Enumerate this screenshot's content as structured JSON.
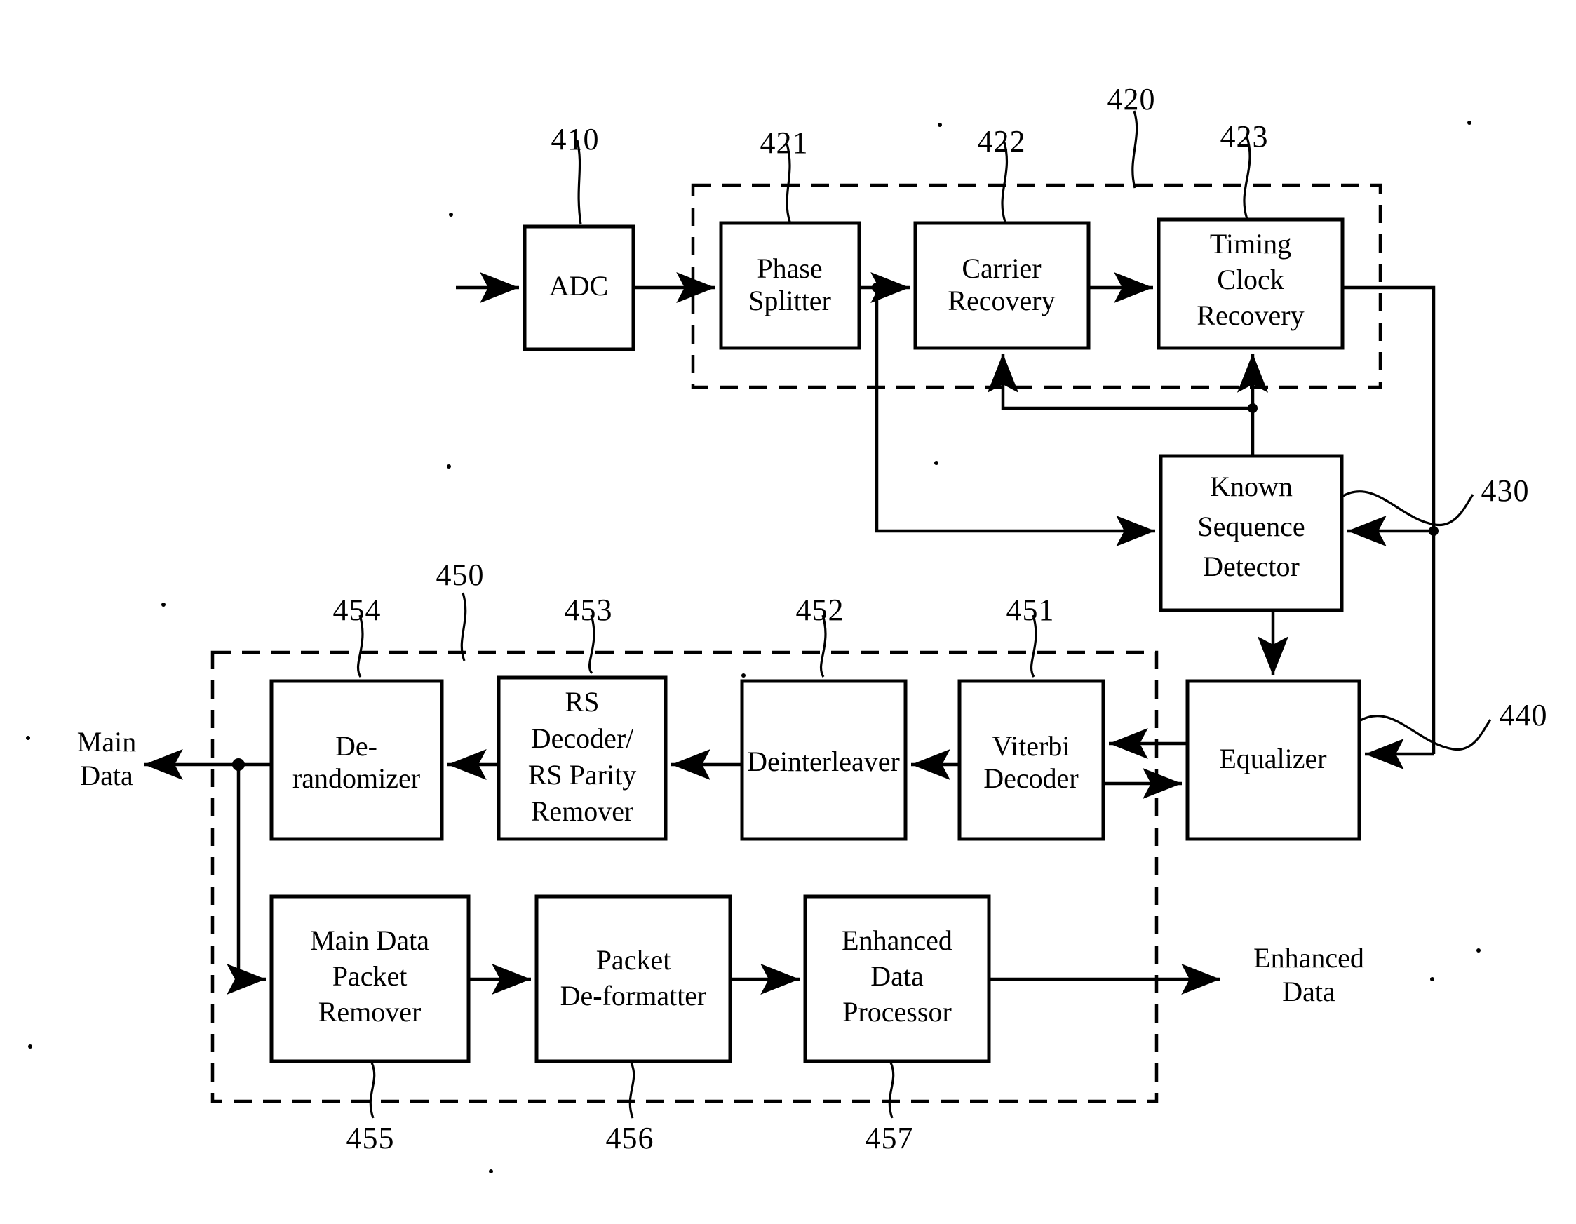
{
  "figure": {
    "type": "patent-block-diagram",
    "title": "Digital broadcast receiver demodulation and decoding block diagram"
  },
  "blocks": [
    {
      "id": "adc",
      "label": "ADC",
      "lines": [
        "ADC"
      ],
      "ref": "410"
    },
    {
      "id": "phase",
      "label": "Phase Splitter",
      "lines": [
        "Phase",
        "Splitter"
      ],
      "ref": "421"
    },
    {
      "id": "carrier",
      "label": "Carrier Recovery",
      "lines": [
        "Carrier",
        "Recovery"
      ],
      "ref": "422"
    },
    {
      "id": "timing",
      "label": "Timing Clock Recovery",
      "lines": [
        "Timing",
        "Clock",
        "Recovery"
      ],
      "ref": "423"
    },
    {
      "id": "ksd",
      "label": "Known Sequence Detector",
      "lines": [
        "Known",
        "Sequence",
        "Detector"
      ],
      "ref": "430"
    },
    {
      "id": "equalizer",
      "label": "Equalizer",
      "lines": [
        "Equalizer"
      ],
      "ref": "440"
    },
    {
      "id": "viterbi",
      "label": "Viterbi Decoder",
      "lines": [
        "Viterbi",
        "Decoder"
      ],
      "ref": "451"
    },
    {
      "id": "deint",
      "label": "Deinterleaver",
      "lines": [
        "Deinterleaver"
      ],
      "ref": "452"
    },
    {
      "id": "rsdec",
      "label": "RS Decoder/ RS Parity Remover",
      "lines": [
        "RS",
        "Decoder/",
        "RS Parity",
        "Remover"
      ],
      "ref": "453"
    },
    {
      "id": "derand",
      "label": "De-randomizer",
      "lines": [
        "De-",
        "randomizer"
      ],
      "ref": "454"
    },
    {
      "id": "mdpr",
      "label": "Main Data Packet Remover",
      "lines": [
        "Main Data",
        "Packet",
        "Remover"
      ],
      "ref": "455"
    },
    {
      "id": "pdf",
      "label": "Packet De-formatter",
      "lines": [
        "Packet",
        "De-formatter"
      ],
      "ref": "456"
    },
    {
      "id": "edp",
      "label": "Enhanced Data Processor",
      "lines": [
        "Enhanced",
        "Data",
        "Processor"
      ],
      "ref": "457"
    }
  ],
  "group_refs": [
    {
      "id": "demodulator",
      "ref": "420",
      "members": [
        "421",
        "422",
        "423"
      ]
    },
    {
      "id": "decoder",
      "ref": "450",
      "members": [
        "451",
        "452",
        "453",
        "454",
        "455",
        "456",
        "457"
      ]
    }
  ],
  "io_labels": {
    "main_data": {
      "lines": [
        "Main",
        "Data"
      ],
      "text": "Main Data"
    },
    "enhanced_data": {
      "lines": [
        "Enhanced",
        "Data"
      ],
      "text": "Enhanced Data"
    }
  },
  "ref_numbers": {
    "r410": "410",
    "r420": "420",
    "r421": "421",
    "r422": "422",
    "r423": "423",
    "r430": "430",
    "r440": "440",
    "r450": "450",
    "r451": "451",
    "r452": "452",
    "r453": "453",
    "r454": "454",
    "r455": "455",
    "r456": "456",
    "r457": "457"
  },
  "block_text": {
    "adc_1": "ADC",
    "phase_1": "Phase",
    "phase_2": "Splitter",
    "carrier_1": "Carrier",
    "carrier_2": "Recovery",
    "timing_1": "Timing",
    "timing_2": "Clock",
    "timing_3": "Recovery",
    "ksd_1": "Known",
    "ksd_2": "Sequence",
    "ksd_3": "Detector",
    "eq_1": "Equalizer",
    "vit_1": "Viterbi",
    "vit_2": "Decoder",
    "deint_1": "Deinterleaver",
    "rs_1": "RS",
    "rs_2": "Decoder/",
    "rs_3": "RS Parity",
    "rs_4": "Remover",
    "derand_1": "De-",
    "derand_2": "randomizer",
    "mdpr_1": "Main Data",
    "mdpr_2": "Packet",
    "mdpr_3": "Remover",
    "pdf_1": "Packet",
    "pdf_2": "De-formatter",
    "edp_1": "Enhanced",
    "edp_2": "Data",
    "edp_3": "Processor",
    "main_data_1": "Main",
    "main_data_2": "Data",
    "enh_data_1": "Enhanced",
    "enh_data_2": "Data"
  },
  "colors": {
    "ink": "#000000",
    "paper": "#ffffff"
  }
}
